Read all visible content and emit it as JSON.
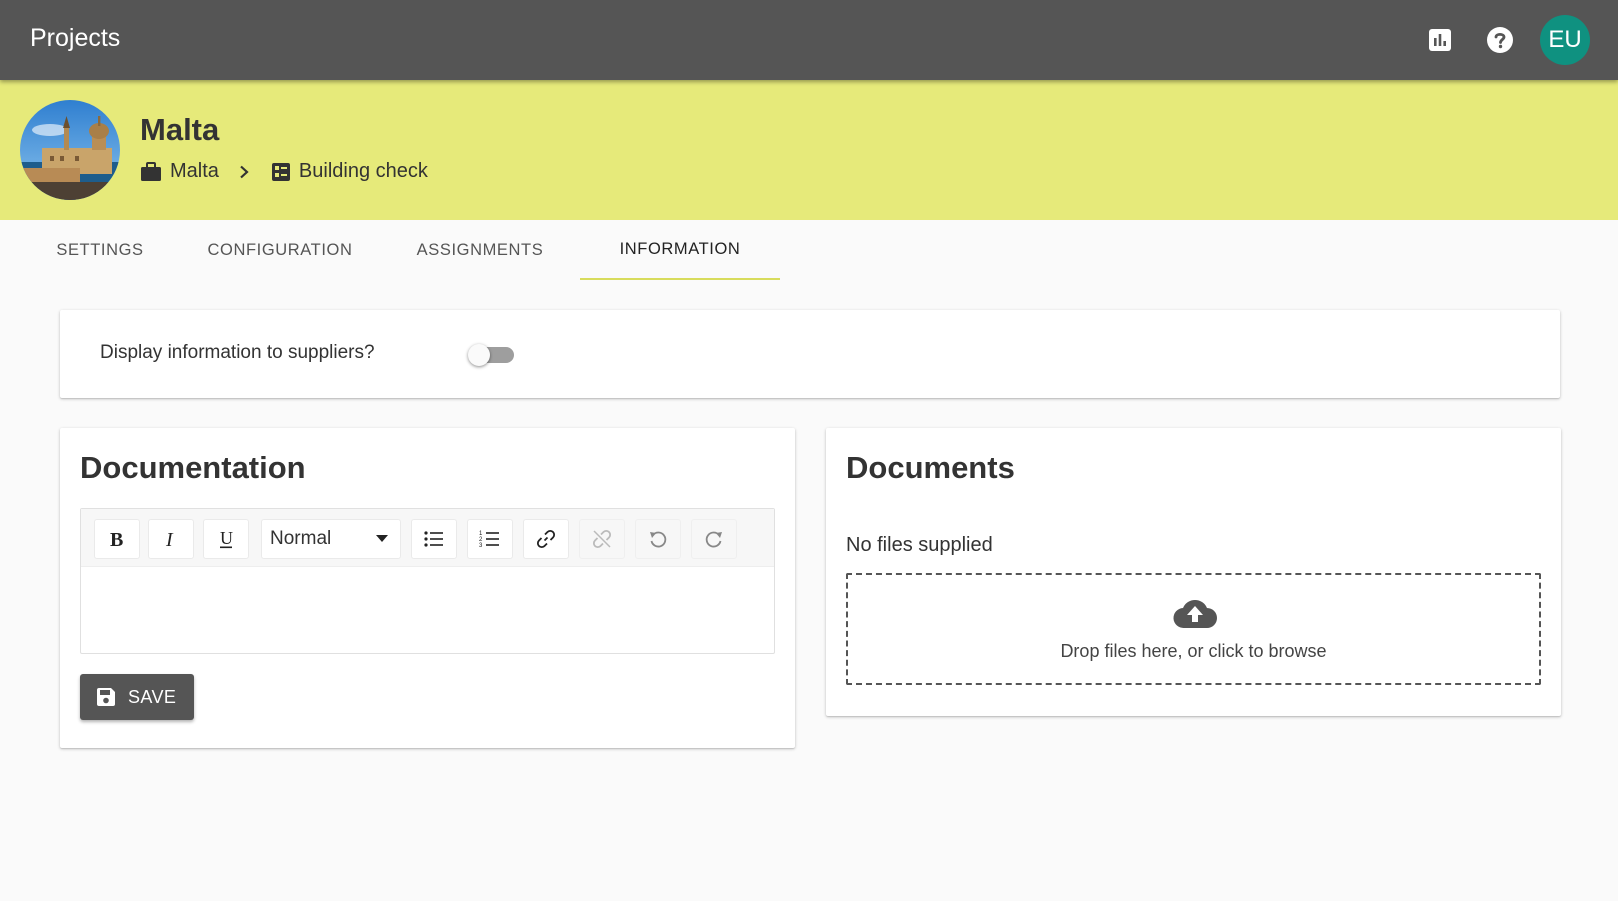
{
  "appbar": {
    "title": "Projects",
    "stats_icon": "bar-chart-icon",
    "help_icon": "help-icon",
    "user_initials": "EU",
    "avatar_color": "#0f9180"
  },
  "project": {
    "title": "Malta",
    "header_color": "#e6ea7a",
    "breadcrumb": [
      {
        "label": "Malta",
        "icon": "briefcase-icon"
      },
      {
        "label": "Building check",
        "icon": "checklist-icon"
      }
    ]
  },
  "tabs": [
    {
      "label": "SETTINGS",
      "active": false
    },
    {
      "label": "CONFIGURATION",
      "active": false
    },
    {
      "label": "ASSIGNMENTS",
      "active": false
    },
    {
      "label": "INFORMATION",
      "active": true
    }
  ],
  "display_toggle": {
    "label": "Display information to suppliers?",
    "checked": false
  },
  "documentation": {
    "heading": "Documentation",
    "format_select": "Normal",
    "toolbar_icons": [
      "bold-icon",
      "italic-icon",
      "underline-icon",
      "bullet-list-icon",
      "numbered-list-icon",
      "link-icon",
      "unlink-icon",
      "undo-icon",
      "redo-icon"
    ],
    "content": "",
    "save_label": "SAVE"
  },
  "documents": {
    "heading": "Documents",
    "empty_text": "No files supplied",
    "dropzone_text": "Drop files here, or click to browse",
    "dropzone_icon": "cloud-upload-icon"
  }
}
